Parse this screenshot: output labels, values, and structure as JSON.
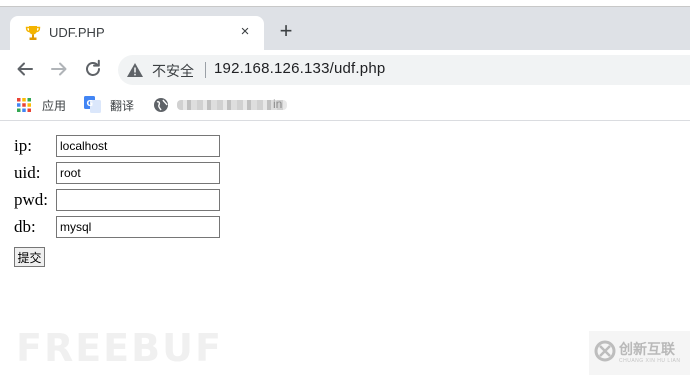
{
  "tab": {
    "title": "UDF.PHP",
    "close_label": "×",
    "new_tab_label": "+"
  },
  "toolbar": {
    "security_label": "不安全",
    "url": "192.168.126.133/udf.php"
  },
  "bookmarks": {
    "apps_label": "应用",
    "translate_label": "翻译",
    "third_label": "in"
  },
  "form": {
    "ip_label": "ip:",
    "ip_value": "localhost",
    "uid_label": "uid:",
    "uid_value": "root",
    "pwd_label": "pwd:",
    "pwd_value": "",
    "db_label": "db:",
    "db_value": "mysql",
    "submit_label": "提交"
  },
  "watermarks": {
    "freebuf": "FREEBUF",
    "brand_cn": "创新互联",
    "brand_en": "CHUANG XIN HU LIAN"
  },
  "icons": {
    "favicon": "trophy-icon",
    "back": "arrow-left-icon",
    "forward": "arrow-right-icon",
    "reload": "reload-icon",
    "warning": "warning-triangle-icon",
    "apps": "apps-grid-icon",
    "translate": "google-translate-icon",
    "site": "globe-icon"
  },
  "colors": {
    "tabstrip_bg": "#dee1e6",
    "omnibox_bg": "#f1f3f4",
    "favicon_gold": "#f4b400"
  }
}
